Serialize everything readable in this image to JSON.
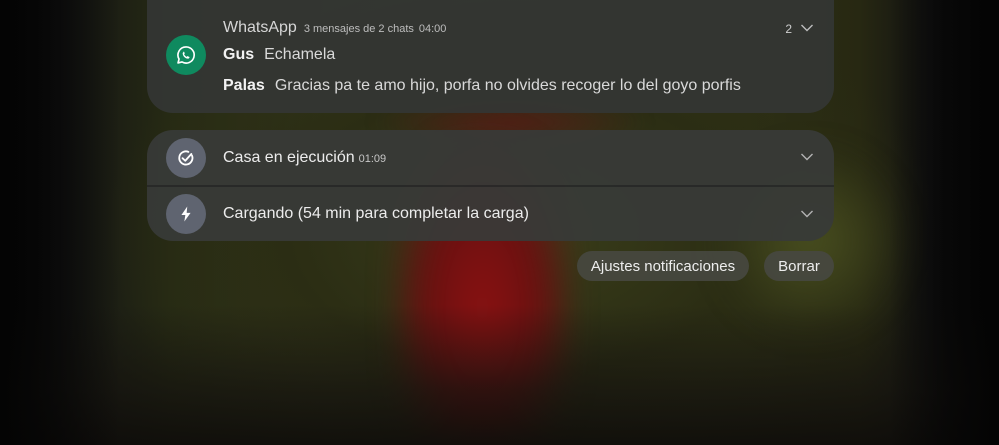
{
  "whatsapp": {
    "app_name": "WhatsApp",
    "summary": "3 mensajes de 2 chats",
    "time": "04:00",
    "count": "2",
    "icon": "whatsapp-icon",
    "color": "#0f8a5f",
    "messages": [
      {
        "sender": "Gus",
        "text": "Echamela"
      },
      {
        "sender": "Palas",
        "text": "Gracias pa te amo hijo, porfa no olvides recoger lo del goyo porfis"
      }
    ]
  },
  "system_notifications": [
    {
      "title": "Casa en ejecución",
      "time": "01:09",
      "icon": "routine-check-icon"
    },
    {
      "title": "Cargando (54 min para completar la carga)",
      "time": "",
      "icon": "lightning-bolt-icon"
    }
  ],
  "actions": {
    "settings_label": "Ajustes notificaciones",
    "clear_label": "Borrar"
  }
}
